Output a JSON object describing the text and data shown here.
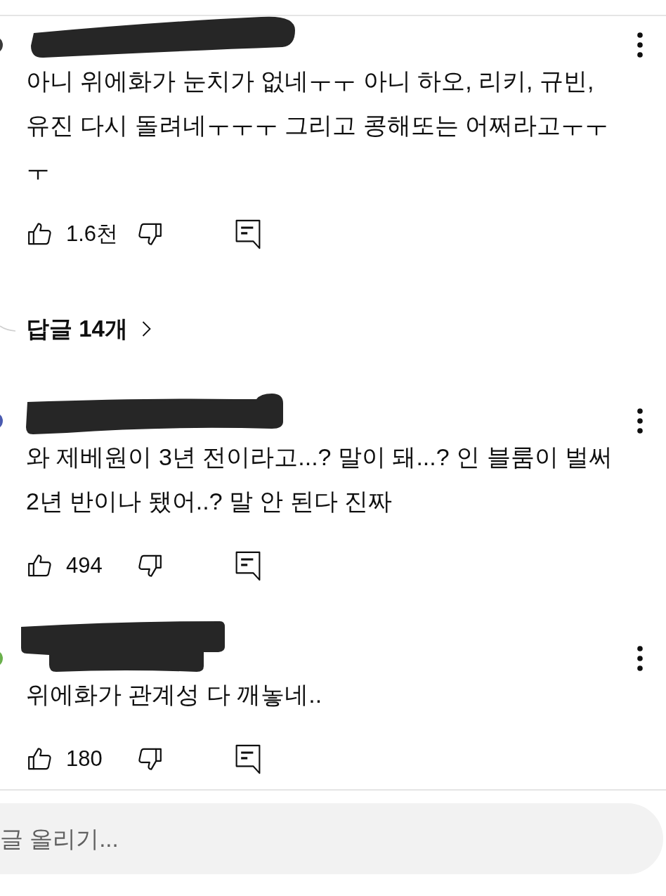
{
  "comments": [
    {
      "avatar": {
        "color": "#3a3a3a"
      },
      "text": "아니 위에화가 눈치가 없네ㅜㅜ 아니 하오, 리키, 규빈, 유진 다시 돌려네ㅜㅜㅜ 그리고 콩해또는 어쩌라고ㅜㅜㅜ",
      "likes": "1.6천",
      "replies": "답글 14개"
    },
    {
      "avatar": {
        "color": "#4a5bb0"
      },
      "text": "와 제베원이 3년 전이라고...? 말이 돼...? 인 블룸이 벌써 2년 반이나 됐어..? 말 안 된다 진짜",
      "likes": "494"
    },
    {
      "avatar": {
        "color": "#6ab04c"
      },
      "text": "위에화가 관계성 다 깨놓네..",
      "likes": "180"
    }
  ],
  "comment_input": {
    "placeholder": "글 올리기..."
  }
}
